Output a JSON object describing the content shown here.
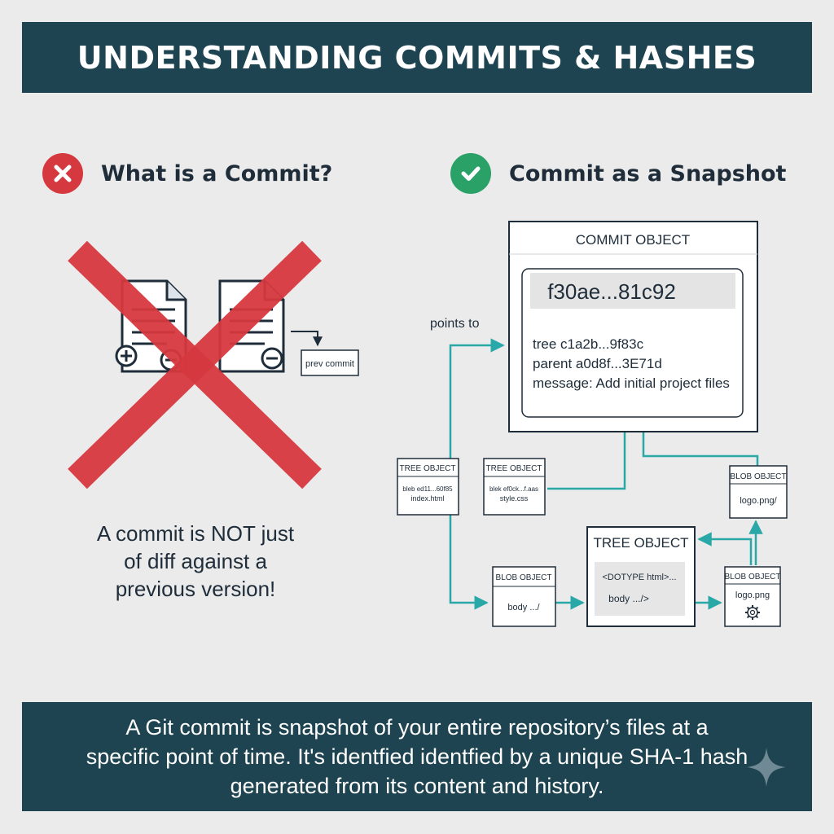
{
  "title": "UNDERSTANDING COMMITS & HASHES",
  "left": {
    "heading": "What is a Commit?",
    "prev_commit_label": "prev commit",
    "caption_lines": [
      "A commit is NOT just",
      "of diff against a",
      "previous version!"
    ]
  },
  "right": {
    "heading": "Commit as a Snapshot",
    "points_to": "points to",
    "commit": {
      "header": "COMMIT OBJECT",
      "hash": "f30ae...81c92",
      "tree": "tree c1a2b...9f83c",
      "parent": "parent a0d8f...3E71d",
      "message": "message: Add initial project files"
    },
    "tree1": {
      "header": "TREE OBJECT",
      "line1": "bleb ed11...60f85",
      "line2": "index.html"
    },
    "tree2": {
      "header": "TREE OBJECT",
      "line1": "blek ef0ck...f.aas",
      "line2": "style.css"
    },
    "blob_top": {
      "header": "BLOB OBJECT",
      "line1": "logo.png/"
    },
    "tree_big": {
      "header": "TREE OBJECT",
      "line1": "<DOTYPE html>...",
      "line2": "body .../>"
    },
    "blob_left": {
      "header": "BLOB OBJECT",
      "line1": "body .../"
    },
    "blob_right": {
      "header": "BLOB OBJECT",
      "line1": "logo.png"
    }
  },
  "footer": {
    "line1": "A Git commit is snapshot of your entire repository’s files at a",
    "line2": "specific point of time. It's identfied identfied by a unique SHA-1 hash",
    "line3": "generated from its content and history."
  },
  "colors": {
    "banner": "#1d4450",
    "cross": "#d6383f",
    "check": "#2aa167",
    "arrow": "#2aa8a8",
    "text_dark": "#1f2d3a"
  },
  "icons": [
    "x-icon",
    "check-icon",
    "document-icon",
    "plus-icon",
    "minus-icon",
    "gear-icon",
    "sparkle-icon"
  ]
}
